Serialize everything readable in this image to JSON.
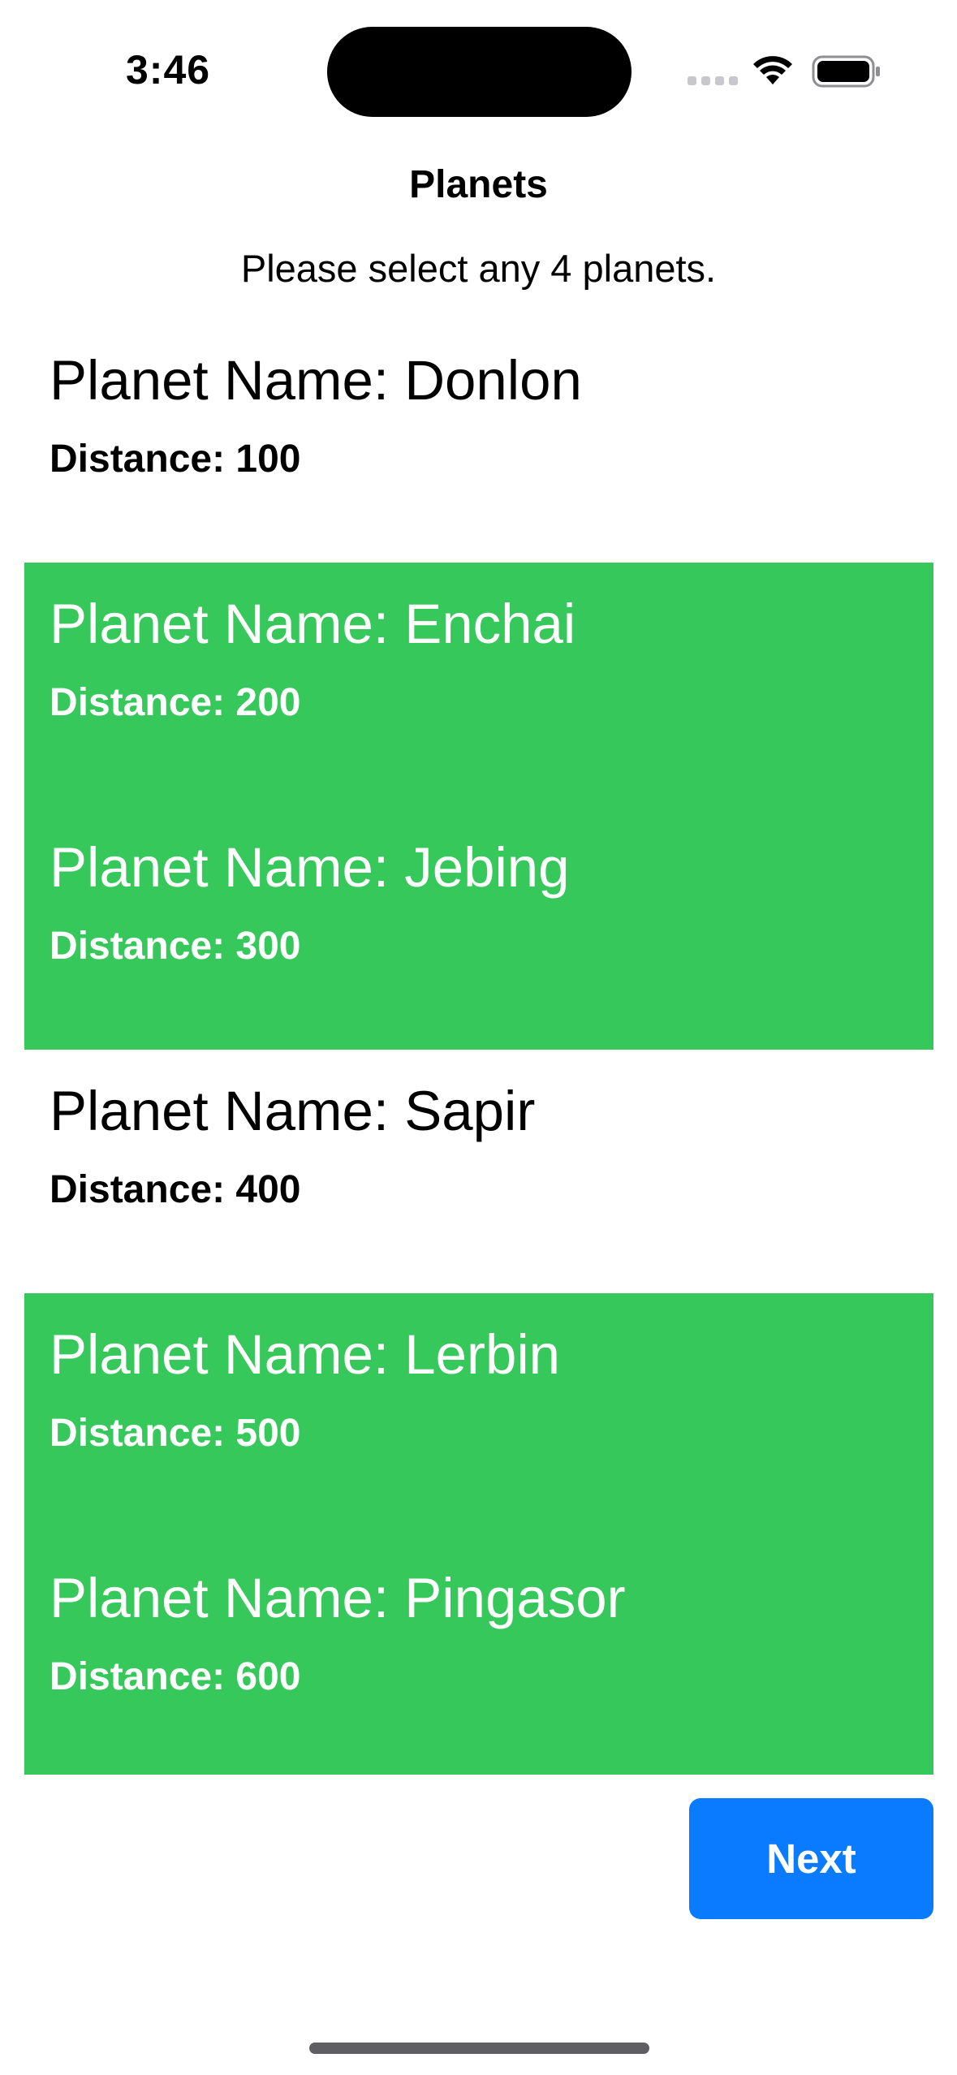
{
  "status_bar": {
    "time": "3:46",
    "icons": [
      "cellular-signal-icon",
      "wifi-icon",
      "battery-icon"
    ]
  },
  "header": {
    "title": "Planets",
    "subtitle": "Please select any 4 planets."
  },
  "planets": [
    {
      "name": "Planet Name: Donlon",
      "distance": "Distance: 100",
      "selected": false
    },
    {
      "name": "Planet Name: Enchai",
      "distance": "Distance: 200",
      "selected": true
    },
    {
      "name": "Planet Name: Jebing",
      "distance": "Distance: 300",
      "selected": true
    },
    {
      "name": "Planet Name: Sapir",
      "distance": "Distance: 400",
      "selected": false
    },
    {
      "name": "Planet Name: Lerbin",
      "distance": "Distance: 500",
      "selected": true
    },
    {
      "name": "Planet Name: Pingasor",
      "distance": "Distance: 600",
      "selected": true
    }
  ],
  "actions": {
    "next_label": "Next"
  },
  "colors": {
    "selected_background": "#37c85b",
    "accent": "#0a7aff"
  }
}
